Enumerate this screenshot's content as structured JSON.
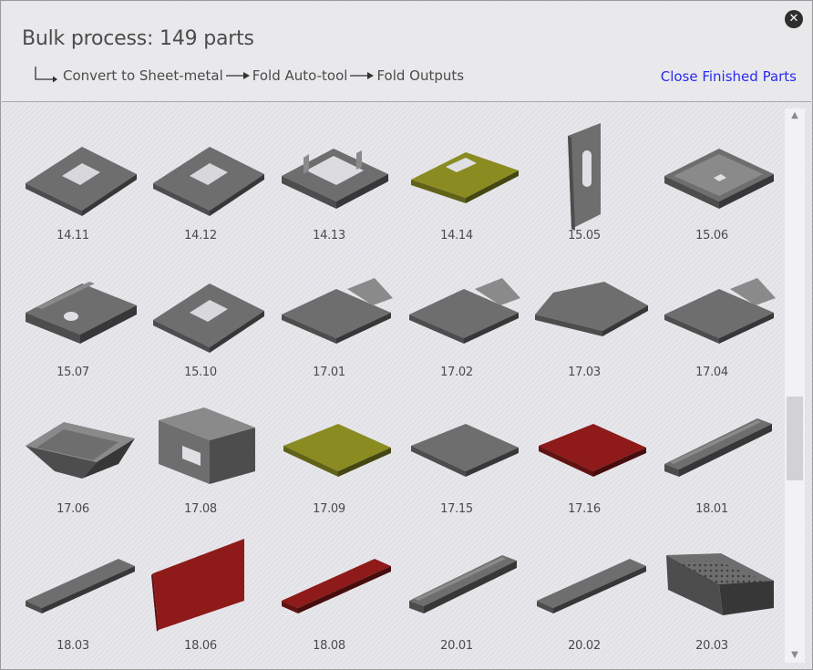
{
  "dialog": {
    "title": "Bulk process: 149 parts",
    "close_icon": "close-x-icon"
  },
  "pipeline": {
    "steps": [
      "Convert to Sheet-metal",
      "Fold Auto-tool",
      "Fold Outputs"
    ]
  },
  "actions": {
    "close_finished_label": "Close Finished Parts",
    "link_color": "#2a2af0"
  },
  "parts": [
    {
      "label": "14.11",
      "color": "#6e6e6e",
      "shape": "plate-hole"
    },
    {
      "label": "14.12",
      "color": "#6e6e6e",
      "shape": "plate-hole"
    },
    {
      "label": "14.13",
      "color": "#6e6e6e",
      "shape": "frame"
    },
    {
      "label": "14.14",
      "color": "#8a8c22",
      "shape": "notched-plate"
    },
    {
      "label": "15.05",
      "color": "#6e6e6e",
      "shape": "vertical-panel"
    },
    {
      "label": "15.06",
      "color": "#6e6e6e",
      "shape": "tray"
    },
    {
      "label": "15.07",
      "color": "#6e6e6e",
      "shape": "channel-hole"
    },
    {
      "label": "15.10",
      "color": "#6e6e6e",
      "shape": "plate-hole"
    },
    {
      "label": "17.01",
      "color": "#6e6e6e",
      "shape": "flanged-plate"
    },
    {
      "label": "17.02",
      "color": "#6e6e6e",
      "shape": "flanged-plate"
    },
    {
      "label": "17.03",
      "color": "#6e6e6e",
      "shape": "chamfer-plate"
    },
    {
      "label": "17.04",
      "color": "#6e6e6e",
      "shape": "flanged-plate"
    },
    {
      "label": "17.06",
      "color": "#6e6e6e",
      "shape": "hopper"
    },
    {
      "label": "17.08",
      "color": "#6e6e6e",
      "shape": "bracket"
    },
    {
      "label": "17.09",
      "color": "#8a8c22",
      "shape": "flat-plate"
    },
    {
      "label": "17.15",
      "color": "#6e6e6e",
      "shape": "flat-plate"
    },
    {
      "label": "17.16",
      "color": "#8e1a1a",
      "shape": "flat-plate"
    },
    {
      "label": "18.01",
      "color": "#6e6e6e",
      "shape": "long-channel"
    },
    {
      "label": "18.03",
      "color": "#6e6e6e",
      "shape": "long-strip"
    },
    {
      "label": "18.06",
      "color": "#8e1a1a",
      "shape": "tall-panel"
    },
    {
      "label": "18.08",
      "color": "#8e1a1a",
      "shape": "long-strip"
    },
    {
      "label": "20.01",
      "color": "#6e6e6e",
      "shape": "long-channel"
    },
    {
      "label": "20.02",
      "color": "#6e6e6e",
      "shape": "long-strip"
    },
    {
      "label": "20.03",
      "color": "#6e6e6e",
      "shape": "perforated-tray"
    }
  ]
}
